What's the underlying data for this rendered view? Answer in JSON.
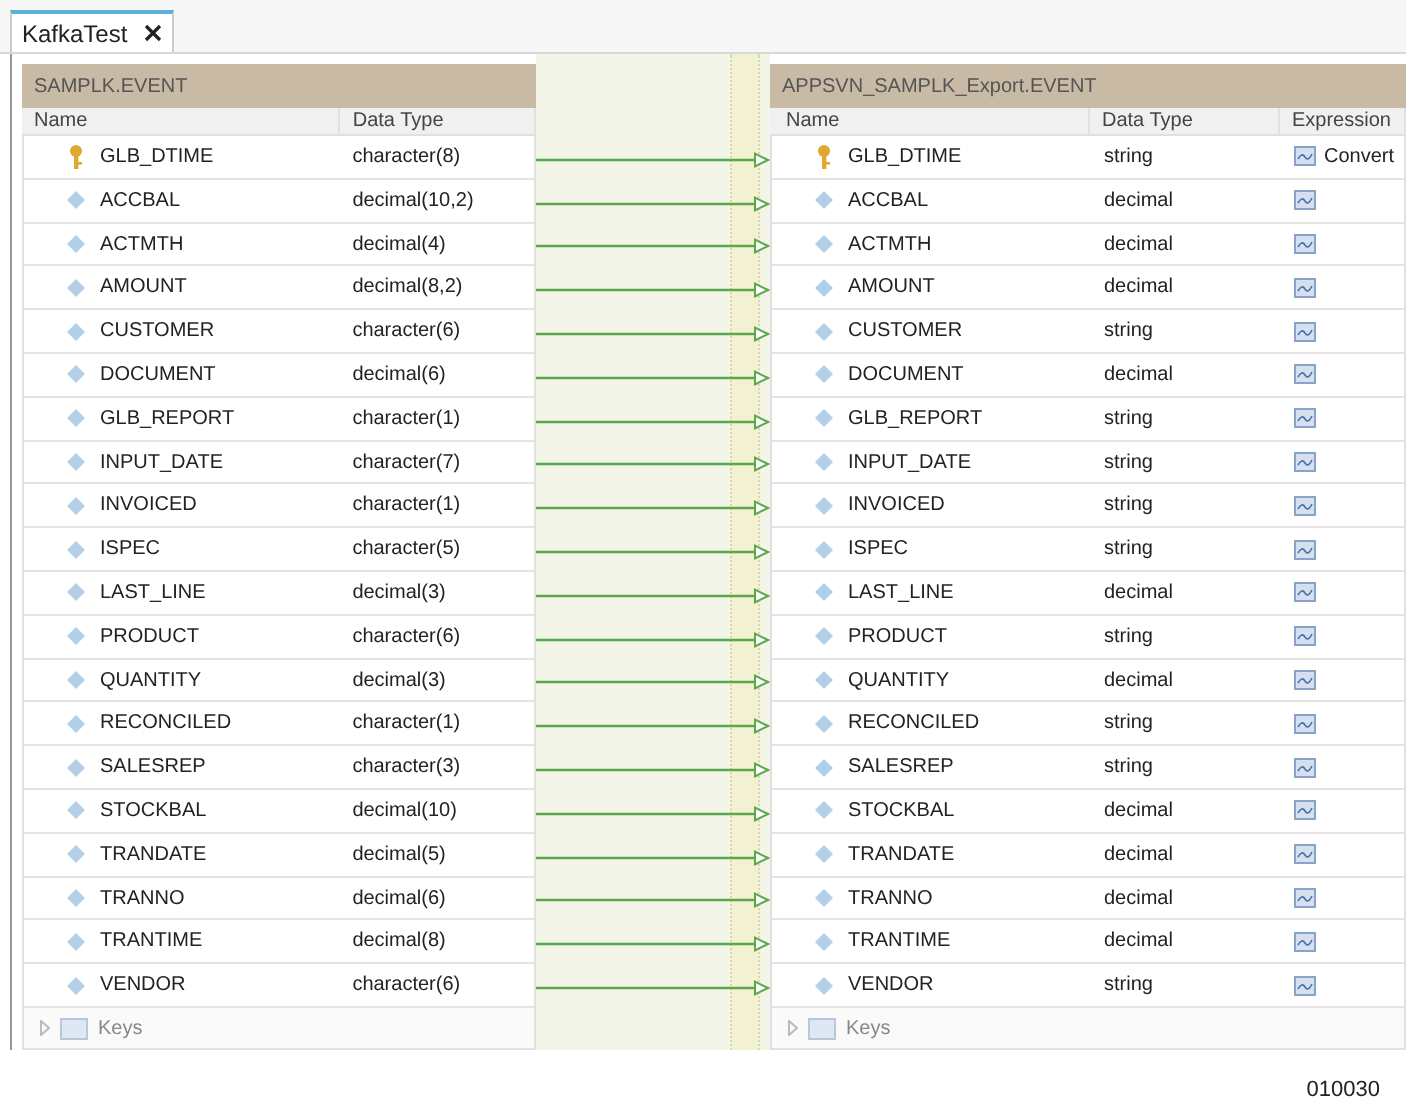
{
  "tabs": [
    {
      "label": "KafkaTest",
      "selected": true,
      "closable": true
    }
  ],
  "source": {
    "title": "SAMPLK.EVENT",
    "columns": [
      "Name",
      "Data Type"
    ],
    "fields": [
      {
        "name": "GLB_DTIME",
        "type": "character(8)",
        "key": true
      },
      {
        "name": "ACCBAL",
        "type": "decimal(10,2)",
        "key": false
      },
      {
        "name": "ACTMTH",
        "type": "decimal(4)",
        "key": false
      },
      {
        "name": "AMOUNT",
        "type": "decimal(8,2)",
        "key": false
      },
      {
        "name": "CUSTOMER",
        "type": "character(6)",
        "key": false
      },
      {
        "name": "DOCUMENT",
        "type": "decimal(6)",
        "key": false
      },
      {
        "name": "GLB_REPORT",
        "type": "character(1)",
        "key": false
      },
      {
        "name": "INPUT_DATE",
        "type": "character(7)",
        "key": false
      },
      {
        "name": "INVOICED",
        "type": "character(1)",
        "key": false
      },
      {
        "name": "ISPEC",
        "type": "character(5)",
        "key": false
      },
      {
        "name": "LAST_LINE",
        "type": "decimal(3)",
        "key": false
      },
      {
        "name": "PRODUCT",
        "type": "character(6)",
        "key": false
      },
      {
        "name": "QUANTITY",
        "type": "decimal(3)",
        "key": false
      },
      {
        "name": "RECONCILED",
        "type": "character(1)",
        "key": false
      },
      {
        "name": "SALESREP",
        "type": "character(3)",
        "key": false
      },
      {
        "name": "STOCKBAL",
        "type": "decimal(10)",
        "key": false
      },
      {
        "name": "TRANDATE",
        "type": "decimal(5)",
        "key": false
      },
      {
        "name": "TRANNO",
        "type": "decimal(6)",
        "key": false
      },
      {
        "name": "TRANTIME",
        "type": "decimal(8)",
        "key": false
      },
      {
        "name": "VENDOR",
        "type": "character(6)",
        "key": false
      }
    ],
    "keys": {
      "label": "Keys",
      "expanded": false
    }
  },
  "target": {
    "title": "APPSVN_SAMPLK_Export.EVENT",
    "columns": [
      "Name",
      "Data Type",
      "Expression"
    ],
    "fields": [
      {
        "name": "GLB_DTIME",
        "type": "string",
        "key": true,
        "linked": true,
        "expression": "Convert"
      },
      {
        "name": "ACCBAL",
        "type": "decimal",
        "key": false,
        "linked": true
      },
      {
        "name": "ACTMTH",
        "type": "decimal",
        "key": false,
        "linked": true
      },
      {
        "name": "AMOUNT",
        "type": "decimal",
        "key": false,
        "linked": true
      },
      {
        "name": "CUSTOMER",
        "type": "string",
        "key": false,
        "linked": true
      },
      {
        "name": "DOCUMENT",
        "type": "decimal",
        "key": false,
        "linked": true
      },
      {
        "name": "GLB_REPORT",
        "type": "string",
        "key": false,
        "linked": true
      },
      {
        "name": "INPUT_DATE",
        "type": "string",
        "key": false,
        "linked": true
      },
      {
        "name": "INVOICED",
        "type": "string",
        "key": false,
        "linked": true
      },
      {
        "name": "ISPEC",
        "type": "string",
        "key": false,
        "linked": true
      },
      {
        "name": "LAST_LINE",
        "type": "decimal",
        "key": false,
        "linked": true
      },
      {
        "name": "PRODUCT",
        "type": "string",
        "key": false,
        "linked": true
      },
      {
        "name": "QUANTITY",
        "type": "decimal",
        "key": false,
        "linked": true
      },
      {
        "name": "RECONCILED",
        "type": "string",
        "key": false,
        "linked": true
      },
      {
        "name": "SALESREP",
        "type": "string",
        "key": false,
        "linked": true
      },
      {
        "name": "STOCKBAL",
        "type": "decimal",
        "key": false,
        "linked": true
      },
      {
        "name": "TRANDATE",
        "type": "decimal",
        "key": false,
        "linked": true
      },
      {
        "name": "TRANNO",
        "type": "decimal",
        "key": false,
        "linked": true
      },
      {
        "name": "TRANTIME",
        "type": "decimal",
        "key": false,
        "linked": true
      },
      {
        "name": "VENDOR",
        "type": "string",
        "key": false,
        "linked": true
      }
    ],
    "keys": {
      "label": "Keys",
      "expanded": false
    }
  },
  "figure_id": "010030"
}
